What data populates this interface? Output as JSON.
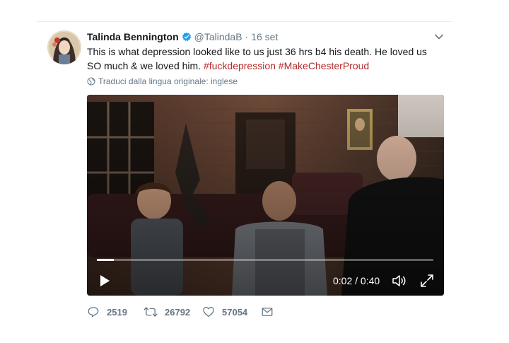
{
  "tweet": {
    "author_name": "Talinda Bennington",
    "handle": "@TalindaB",
    "separator": "·",
    "time": "16 set",
    "text_main": "This is what depression looked like to us just 36 hrs b4 his death. He loved us SO much & we loved him. ",
    "hashtag_1": "#fuckdepression",
    "hashtag_2": "#MakeChesterProud",
    "translate_label": "Traduci dalla lingua originale: inglese"
  },
  "video": {
    "current_time": "0:02",
    "duration": "0:40",
    "time_separator": " / ",
    "progress_fraction": 0.05
  },
  "actions": {
    "replies": "2519",
    "retweets": "26792",
    "likes": "57054"
  },
  "colors": {
    "hashtag": "#b42a2a",
    "muted": "#657786",
    "verified": "#1da1f2"
  },
  "icons": [
    "verified-badge-icon",
    "chevron-down-icon",
    "globe-icon",
    "play-icon",
    "volume-icon",
    "fullscreen-icon",
    "reply-icon",
    "retweet-icon",
    "like-icon",
    "message-icon"
  ]
}
